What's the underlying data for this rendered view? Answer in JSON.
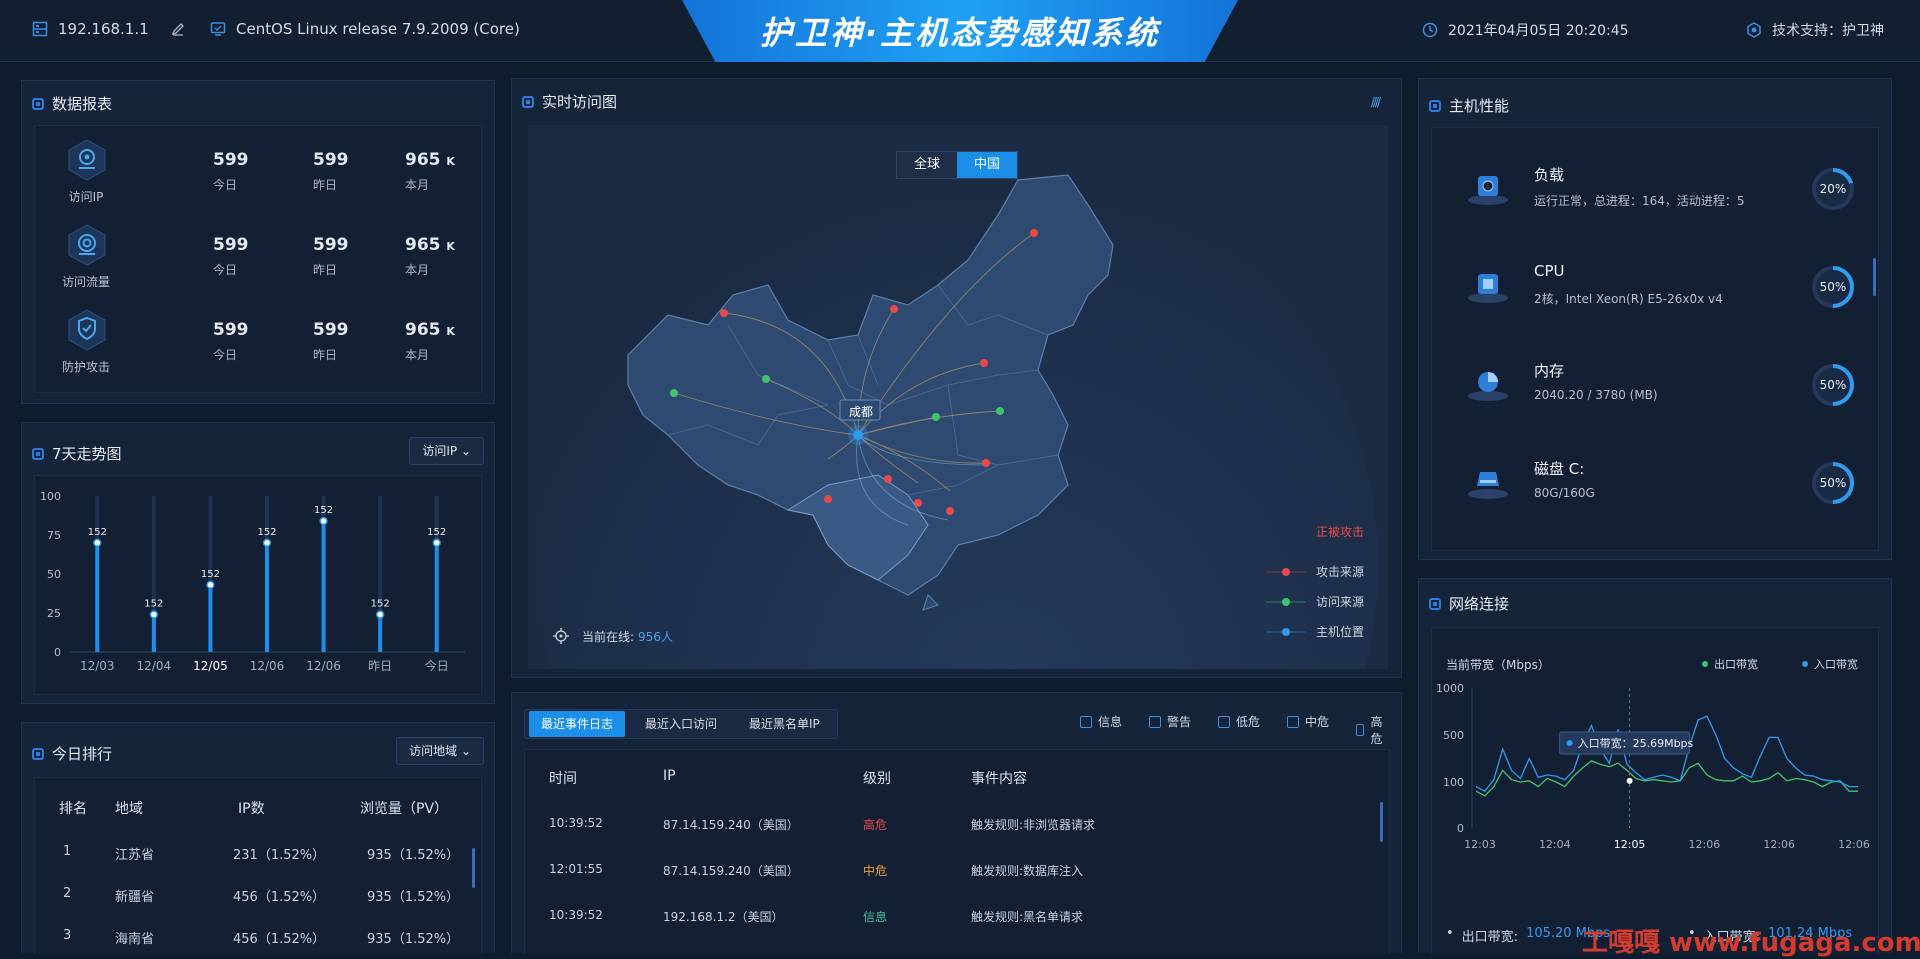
{
  "topbar": {
    "ip": "192.168.1.1",
    "os": "CentOS Linux release 7.9.2009 (Core)",
    "title": "护卫神·主机态势感知系统",
    "datetime": "2021年04月05日 20:20:45",
    "support": "技术支持：护卫神"
  },
  "data_report": {
    "title": "数据报表",
    "rows": [
      {
        "label": "访问IP",
        "today": "599",
        "today_label": "今日",
        "yesterday": "599",
        "yesterday_label": "昨日",
        "month": "965",
        "month_unit": "K",
        "month_label": "本月",
        "icon": "location-pin-icon"
      },
      {
        "label": "访问流量",
        "today": "599",
        "today_label": "今日",
        "yesterday": "599",
        "yesterday_label": "昨日",
        "month": "965",
        "month_unit": "K",
        "month_label": "本月",
        "icon": "traffic-icon"
      },
      {
        "label": "防护攻击",
        "today": "599",
        "today_label": "今日",
        "yesterday": "599",
        "yesterday_label": "昨日",
        "month": "965",
        "month_unit": "K",
        "month_label": "本月",
        "icon": "shield-icon"
      }
    ]
  },
  "trend": {
    "title": "7天走势图",
    "dropdown": "访问IP ⌄"
  },
  "chart_data": [
    {
      "type": "bar",
      "categories": [
        "12/03",
        "12/04",
        "12/05",
        "12/06",
        "12/06",
        "昨日",
        "今日"
      ],
      "values": [
        70,
        24,
        43,
        70,
        84,
        24,
        70
      ],
      "data_labels": [
        "152",
        "152",
        "152",
        "152",
        "152",
        "152",
        "152"
      ],
      "ylim": [
        0,
        100
      ],
      "yticks": [
        0,
        25,
        50,
        75,
        100
      ],
      "highlight": "12/05"
    },
    {
      "type": "line",
      "title": "当前带宽（Mbps）",
      "x_ticks": [
        "12:03",
        "12:04",
        "12:05",
        "12:06",
        "12:06",
        "12:06"
      ],
      "yticks": [
        "0",
        "100",
        "500",
        "1000"
      ],
      "series": [
        {
          "name": "出口带宽",
          "color": "#3ec46d",
          "values": [
            80,
            70,
            90,
            200,
            120,
            100,
            110,
            90,
            130,
            100,
            90,
            150,
            220,
            280,
            250,
            230,
            260,
            200,
            130,
            110,
            120,
            110,
            100,
            110,
            220,
            260,
            160,
            120,
            110,
            110,
            150,
            100,
            110,
            130,
            180,
            110,
            130,
            120,
            100,
            90,
            100,
            110,
            80,
            80
          ]
        },
        {
          "name": "入口带宽",
          "color": "#2f9bf0",
          "values": [
            90,
            80,
            120,
            380,
            200,
            130,
            300,
            140,
            160,
            150,
            120,
            200,
            420,
            600,
            380,
            260,
            560,
            250,
            180,
            120,
            140,
            160,
            140,
            110,
            400,
            660,
            700,
            500,
            300,
            220,
            170,
            140,
            320,
            480,
            480,
            300,
            220,
            160,
            150,
            120,
            110,
            100,
            90,
            90
          ]
        }
      ],
      "tooltip": "入口带宽：25.69Mbps",
      "legend_position": "top-right"
    }
  ],
  "ranking": {
    "title": "今日排行",
    "dropdown": "访问地域 ⌄",
    "headers": [
      "排名",
      "地域",
      "IP数",
      "浏览量（PV）"
    ],
    "rows": [
      [
        "1",
        "江苏省",
        "231（1.52%）",
        "935（1.52%）"
      ],
      [
        "2",
        "新疆省",
        "456（1.52%）",
        "935（1.52%）"
      ],
      [
        "3",
        "海南省",
        "456（1.52%）",
        "935（1.52%）"
      ]
    ]
  },
  "map": {
    "title": "实时访问图",
    "tab_global": "全球",
    "tab_china": "中国",
    "city": "成都",
    "online_label": "当前在线:",
    "online_value": "956人",
    "under_attack": "正被攻击",
    "legend": [
      "攻击来源",
      "访问来源",
      "主机位置"
    ],
    "colors": {
      "attack": "#e84a4a",
      "visit": "#3ec46d",
      "host": "#2f9bf0"
    }
  },
  "events": {
    "tabs": [
      "最近事件日志",
      "最近入口访问",
      "最近黑名单IP"
    ],
    "filters": [
      "信息",
      "警告",
      "低危",
      "中危",
      "高危"
    ],
    "headers": [
      "时间",
      "IP",
      "级别",
      "事件内容"
    ],
    "rows": [
      {
        "time": "10:39:52",
        "ip": "87.14.159.240（美国）",
        "level": "高危",
        "level_color": "#e84a4a",
        "content": "触发规则:非浏览器请求"
      },
      {
        "time": "12:01:55",
        "ip": "87.14.159.240（美国）",
        "level": "中危",
        "level_color": "#f0a030",
        "content": "触发规则:数据库注入"
      },
      {
        "time": "10:39:52",
        "ip": "192.168.1.2（美国）",
        "level": "信息",
        "level_color": "#3ec4a0",
        "content": "触发规则:黑名单请求"
      }
    ]
  },
  "perf": {
    "title": "主机性能",
    "items": [
      {
        "name": "负载",
        "desc": "运行正常，总进程：164，活动进程：5",
        "value": "20%",
        "fraction": 0.2,
        "icon": "load-icon"
      },
      {
        "name": "CPU",
        "desc": "2核，Intel Xeon(R) E5-26x0x v4",
        "value": "50%",
        "fraction": 0.5,
        "icon": "cpu-icon"
      },
      {
        "name": "内存",
        "desc": "2040.20 / 3780 (MB)",
        "value": "50%",
        "fraction": 0.5,
        "icon": "memory-icon"
      },
      {
        "name": "磁盘 C:",
        "desc": "80G/160G",
        "value": "50%",
        "fraction": 0.5,
        "icon": "disk-icon"
      }
    ]
  },
  "network": {
    "title": "网络连接",
    "out_label": "出口带宽:",
    "out_value": "105.20 Mbps",
    "in_label": "入口带宽:",
    "in_value": "101.24 Mbps"
  },
  "watermark": "工嘎嘎 www.fugaga.com"
}
